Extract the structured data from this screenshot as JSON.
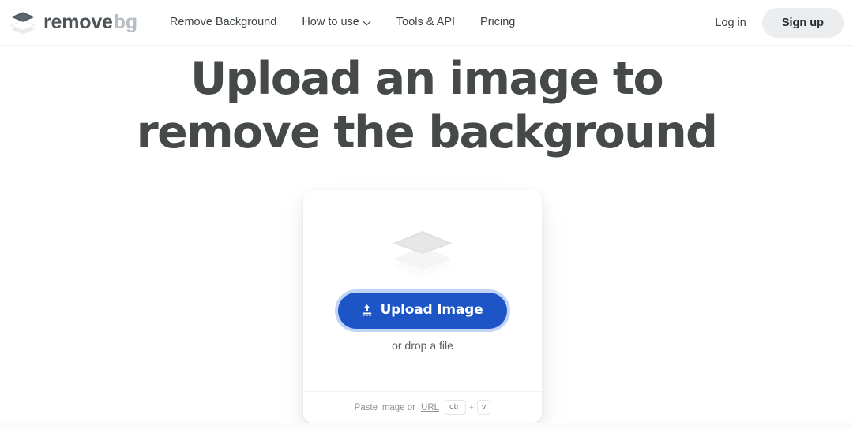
{
  "header": {
    "brand": {
      "icon": "layers-stack-icon",
      "word_primary": "remove",
      "word_secondary": "bg"
    },
    "nav": [
      {
        "label": "Remove Background",
        "has_chevron": false
      },
      {
        "label": "How to use",
        "has_chevron": true
      },
      {
        "label": "Tools & API",
        "has_chevron": false
      },
      {
        "label": "Pricing",
        "has_chevron": false
      }
    ],
    "login_label": "Log in",
    "signup_label": "Sign up"
  },
  "hero": {
    "headline": "Upload an image to\nremove the background"
  },
  "upload_card": {
    "placeholder_icon": "layers-stack-icon",
    "upload_button": {
      "label": "Upload Image",
      "icon": "upload-arrow-icon"
    },
    "drop_text": "or drop a file",
    "footer": {
      "paste_label": "Paste image or",
      "url_link": "URL",
      "key_modifier": "ctrl",
      "key_plus": "+",
      "key_letter": "v"
    }
  },
  "colors": {
    "page_background": "#ffffff",
    "brand_dark": "#4e5356",
    "brand_light": "#b7bdc2",
    "headline": "#46494a",
    "accent_blue": "#1d55c7",
    "focus_ring": "rgba(63,120,228,0.32)",
    "signup_pill": "#ecedef",
    "muted_text": "#8d9398"
  }
}
